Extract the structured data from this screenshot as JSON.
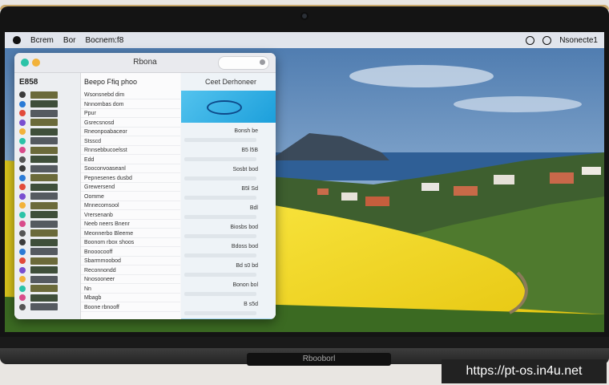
{
  "menubar": {
    "app_name": "Bcrem",
    "menu_1": "Bor",
    "menu_2": "Bocnem:f8",
    "clock": "Nsonecte1"
  },
  "window": {
    "title": "Rbona",
    "search_placeholder": ""
  },
  "sidebar": {
    "header": "E858"
  },
  "list": {
    "header": "Beepo Ffiq phoo",
    "rows": [
      "Wsonsnebd  dim",
      "Nnnombas  dom",
      "Ppur",
      "Gsrecsnosd",
      "Rneonpoabaceor",
      "Stsscd",
      "Rnnsebbucoelsst",
      "Edd",
      "Sooconvoaseanl",
      "Pepnesenes  dusbd",
      "Grewersend",
      "Oomme",
      "Mnnecomsool",
      "Vrersenanb",
      "Neeb neers  Bnenr",
      "Meonnerbo Bleeme",
      "Boonom rbox  shoos",
      "Bnooocooff",
      "Sbarmmoobod",
      "Reconnondd",
      "Nnosooneer",
      "Nn",
      "Mbagb",
      "Boone  rbnooff"
    ]
  },
  "detail": {
    "header": "Ceet Derhoneer",
    "values": [
      "Bonsh be",
      "B5 l5B",
      "Sosbt bod",
      "B5l  Sd",
      "Bdl",
      "Biosbs bod",
      "Bdoss bod",
      "Bd  s0 bd",
      "Bonon bol",
      "B  s5d"
    ]
  },
  "dock_brand": "Rbooborl",
  "watermark": "https://pt-os.in4u.net",
  "colors": {
    "sky": "#5b86b8",
    "sea": "#2f5f96",
    "rapeseed": "#f4da1c",
    "accent_blue": "#1c9fdb",
    "selection": "#9fd3f2"
  }
}
